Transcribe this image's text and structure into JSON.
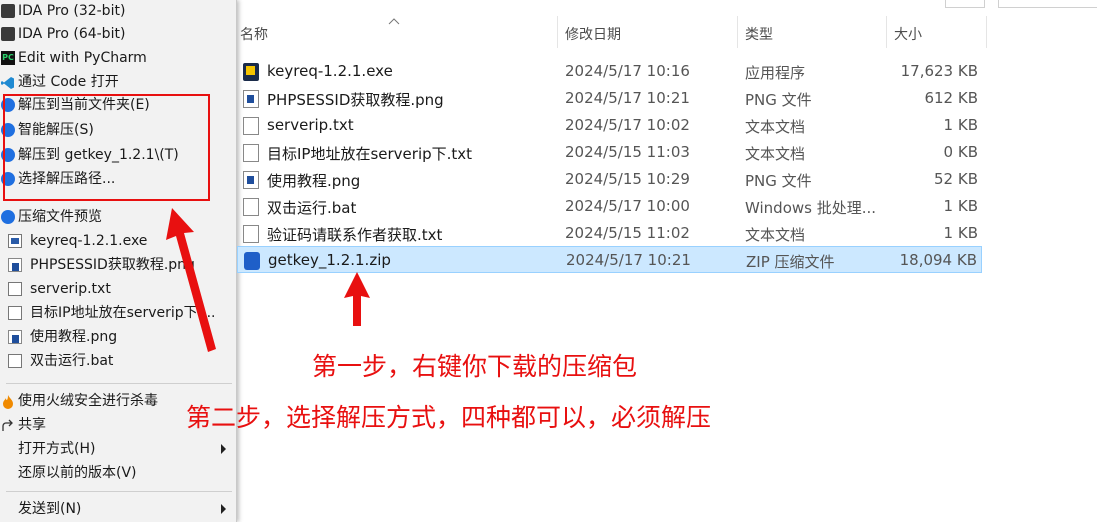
{
  "context_menu": {
    "items_top": [
      {
        "label": "IDA Pro (32-bit)",
        "icon": "ida-icon"
      },
      {
        "label": "IDA Pro (64-bit)",
        "icon": "ida-icon"
      },
      {
        "label": "Edit with PyCharm",
        "icon": "pycharm-icon"
      },
      {
        "label": "通过 Code 打开",
        "icon": "vscode-icon"
      },
      {
        "label": "解压到当前文件夹(E)",
        "icon": "bandizip-icon"
      },
      {
        "label": "智能解压(S)",
        "icon": "bandizip-icon"
      },
      {
        "label": "解压到 getkey_1.2.1\\(T)",
        "icon": "bandizip-icon"
      },
      {
        "label": "选择解压路径...",
        "icon": "bandizip-icon"
      }
    ],
    "preview_label": "压缩文件预览",
    "preview_items": [
      {
        "label": "keyreq-1.2.1.exe"
      },
      {
        "label": "PHPSESSID获取教程.png"
      },
      {
        "label": "serverip.txt"
      },
      {
        "label": "目标IP地址放在serverip下...."
      },
      {
        "label": "使用教程.png"
      },
      {
        "label": "双击运行.bat"
      }
    ],
    "items_bottom": [
      {
        "label": "使用火绒安全进行杀毒",
        "icon": "huorong-icon"
      },
      {
        "label": "共享",
        "icon": "share-icon"
      },
      {
        "label": "打开方式(H)",
        "icon": ""
      },
      {
        "label": "还原以前的版本(V)",
        "icon": ""
      },
      {
        "label": "发送到(N)",
        "icon": ""
      }
    ]
  },
  "columns": {
    "name": "名称",
    "date": "修改日期",
    "type": "类型",
    "size": "大小"
  },
  "files": [
    {
      "name": "keyreq-1.2.1.exe",
      "date": "2024/5/17 10:16",
      "type": "应用程序",
      "size": "17,623 KB",
      "kind": "exe"
    },
    {
      "name": "PHPSESSID获取教程.png",
      "date": "2024/5/17 10:21",
      "type": "PNG 文件",
      "size": "612 KB",
      "kind": "png"
    },
    {
      "name": "serverip.txt",
      "date": "2024/5/17 10:02",
      "type": "文本文档",
      "size": "1 KB",
      "kind": "txt"
    },
    {
      "name": "目标IP地址放在serverip下.txt",
      "date": "2024/5/15 11:03",
      "type": "文本文档",
      "size": "0 KB",
      "kind": "txt"
    },
    {
      "name": "使用教程.png",
      "date": "2024/5/15 10:29",
      "type": "PNG 文件",
      "size": "52 KB",
      "kind": "png"
    },
    {
      "name": "双击运行.bat",
      "date": "2024/5/17 10:00",
      "type": "Windows 批处理...",
      "size": "1 KB",
      "kind": "bat"
    },
    {
      "name": "验证码请联系作者获取.txt",
      "date": "2024/5/15 11:02",
      "type": "文本文档",
      "size": "1 KB",
      "kind": "txt"
    },
    {
      "name": "getkey_1.2.1.zip",
      "date": "2024/5/17 10:21",
      "type": "ZIP 压缩文件",
      "size": "18,094 KB",
      "kind": "zip",
      "selected": true
    }
  ],
  "annotations": {
    "step1": "第一步，右键你下载的压缩包",
    "step2": "第二步，选择解压方式，四种都可以，必须解压",
    "color": "#e81010"
  }
}
